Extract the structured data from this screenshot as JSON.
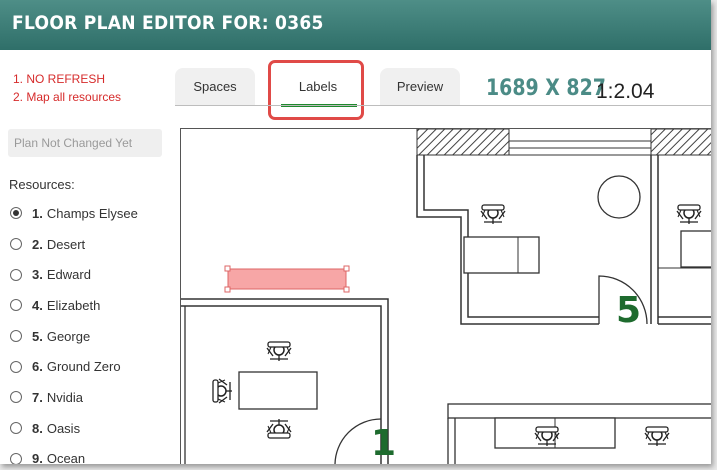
{
  "header": {
    "title": "FLOOR PLAN EDITOR FOR: 0365"
  },
  "notes": [
    "1. NO REFRESH",
    "2. Map all resources"
  ],
  "tabs": [
    {
      "label": "Spaces",
      "active": false
    },
    {
      "label": "Labels",
      "active": true
    },
    {
      "label": "Preview",
      "active": false
    }
  ],
  "dimensions": {
    "size": "1689 X 827",
    "scale": "1:2.04"
  },
  "status": {
    "text": "Plan Not Changed Yet"
  },
  "resources": {
    "label": "Resources:",
    "selected": 0,
    "items": [
      {
        "num": "1.",
        "name": "Champs Elysee"
      },
      {
        "num": "2.",
        "name": "Desert"
      },
      {
        "num": "3.",
        "name": "Edward"
      },
      {
        "num": "4.",
        "name": "Elizabeth"
      },
      {
        "num": "5.",
        "name": "George"
      },
      {
        "num": "6.",
        "name": "Ground Zero"
      },
      {
        "num": "7.",
        "name": "Nvidia"
      },
      {
        "num": "8.",
        "name": "Oasis"
      },
      {
        "num": "9.",
        "name": "Ocean"
      }
    ]
  },
  "plan": {
    "room_labels": [
      "5",
      "1"
    ],
    "label_color": "#1e6b2e",
    "selection_color": "#f7a6a6"
  },
  "colors": {
    "header": "#3b7c76",
    "accent_green": "#1f8a2e",
    "note_red": "#d62b2b",
    "highlight_red": "#e04a47",
    "dims_teal": "#4b8b86"
  }
}
